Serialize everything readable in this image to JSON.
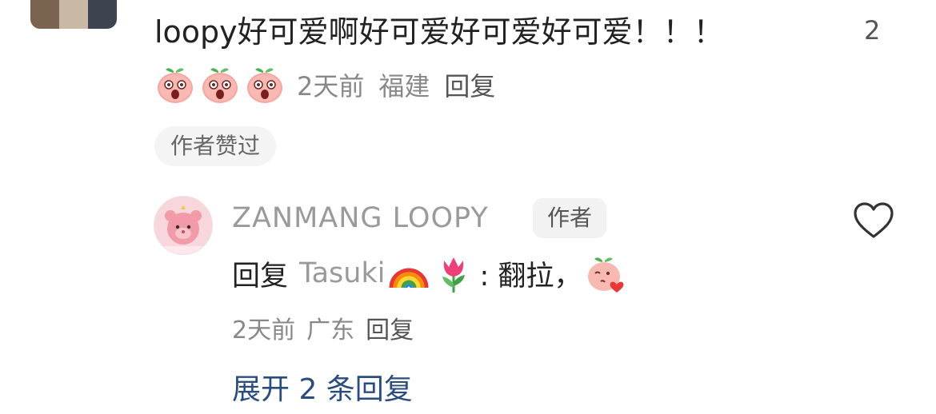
{
  "comment": {
    "text": "loopy好可爱啊好可爱好可爱好可爱！！！",
    "like_count": "2",
    "emojis": [
      "shocked-peach-icon",
      "shocked-peach-icon",
      "shocked-peach-icon"
    ],
    "time": "2天前",
    "location": "福建",
    "reply_label": "回复",
    "author_liked_badge": "作者赞过"
  },
  "reply": {
    "author_name": "ZANMANG LOOPY",
    "author_badge": "作者",
    "prefix": "回复",
    "reply_to_user": "Tasuki",
    "inline_icons": [
      "rainbow-icon",
      "tulip-icon"
    ],
    "body": ": 翻拉，",
    "trailing_icon": "kiss-peach-icon",
    "time": "2天前",
    "location": "广东",
    "reply_label": "回复"
  },
  "expand": {
    "label": "展开 2 条回复"
  },
  "colors": {
    "link_blue": "#2b4d7e",
    "muted_gray": "#888888",
    "badge_bg": "#f2f2f2"
  }
}
